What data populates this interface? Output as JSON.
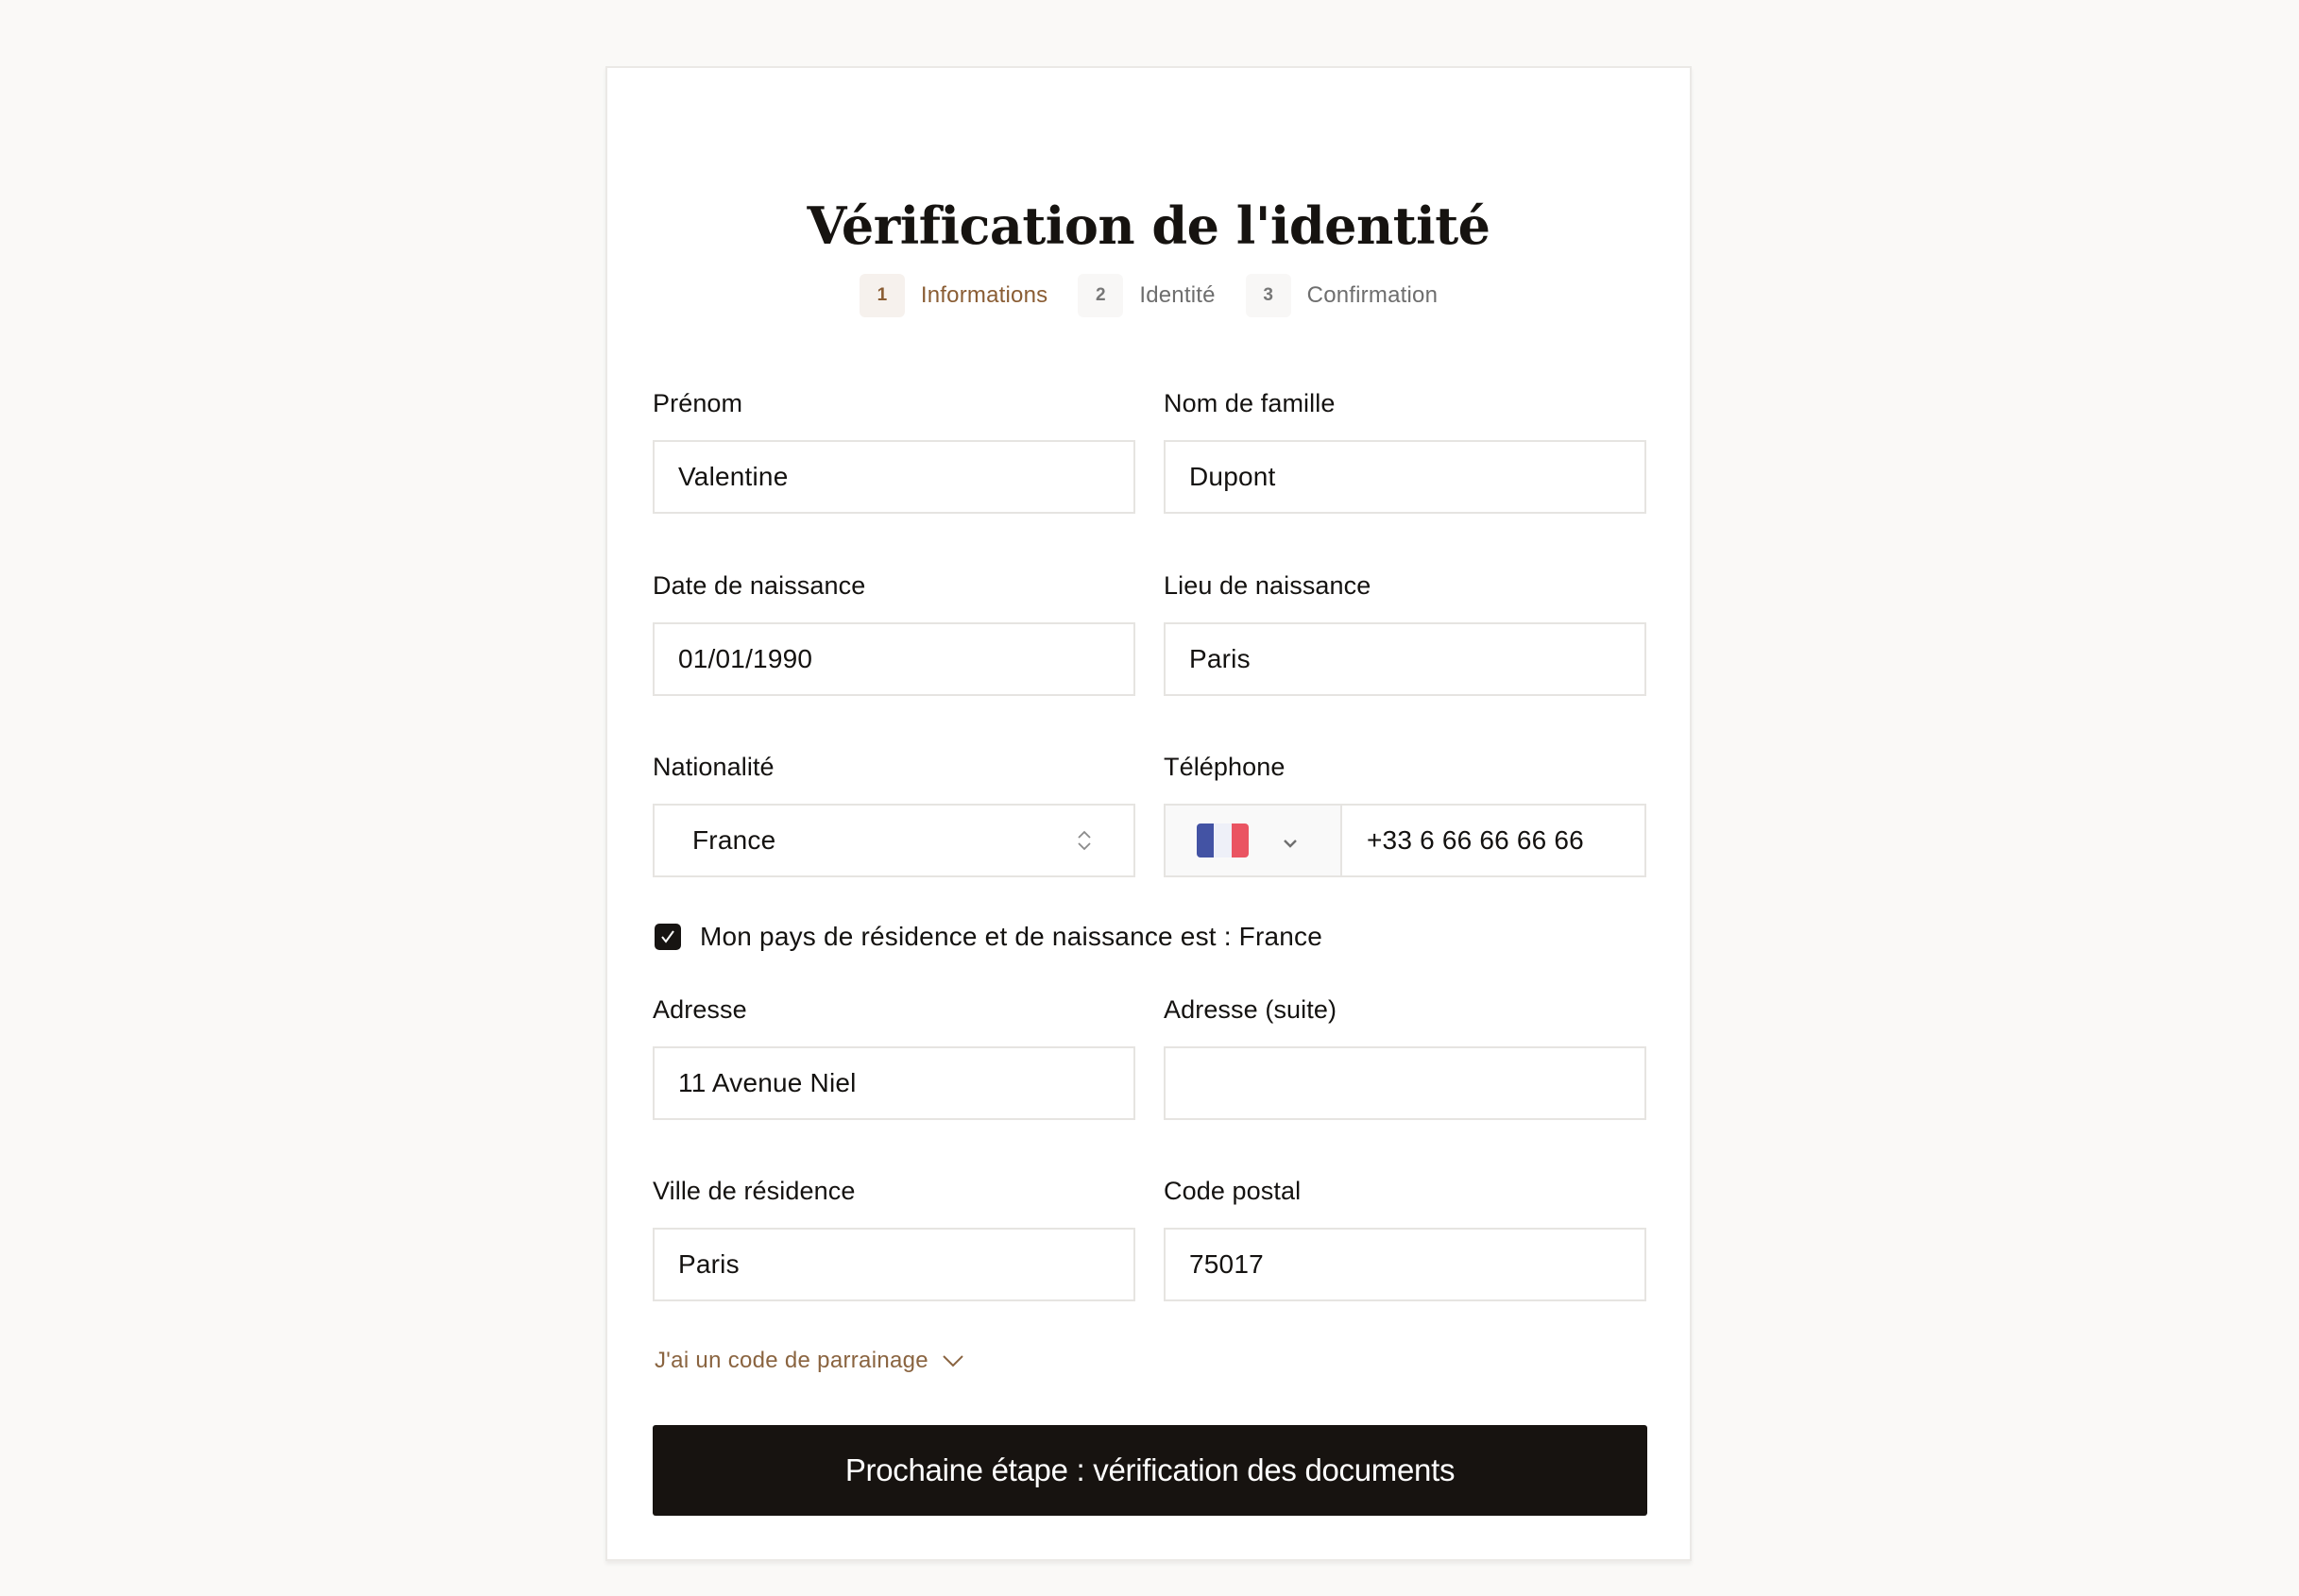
{
  "page": {
    "title": "Vérification de l'identité"
  },
  "steps": [
    {
      "number": "1",
      "label": "Informations",
      "active": true
    },
    {
      "number": "2",
      "label": "Identité",
      "active": false
    },
    {
      "number": "3",
      "label": "Confirmation",
      "active": false
    }
  ],
  "form": {
    "first_name": {
      "label": "Prénom",
      "value": "Valentine"
    },
    "last_name": {
      "label": "Nom de famille",
      "value": "Dupont"
    },
    "birth_date": {
      "label": "Date de naissance",
      "value": "01/01/1990"
    },
    "birth_place": {
      "label": "Lieu de naissance",
      "value": "Paris"
    },
    "nationality": {
      "label": "Nationalité",
      "value": "France",
      "icon": "chevron-up-down-icon"
    },
    "phone": {
      "label": "Téléphone",
      "country_flag": "france-flag",
      "country_colors": [
        "#4353a4",
        "#eef0f8",
        "#ea5462"
      ],
      "value": "+33 6 66 66 66 66",
      "icon": "chevron-down-icon"
    },
    "same_country_checkbox": {
      "label": "Mon pays de résidence et de naissance est : France",
      "checked": true
    },
    "address": {
      "label": "Adresse",
      "value": "11 Avenue Niel"
    },
    "address_2": {
      "label": "Adresse (suite)",
      "value": ""
    },
    "city": {
      "label": "Ville de résidence",
      "value": "Paris"
    },
    "postal_code": {
      "label": "Code postal",
      "value": "75017"
    }
  },
  "referral": {
    "label": "J'ai un code de parrainage",
    "icon": "chevron-down-icon"
  },
  "submit": {
    "label": "Prochaine étape : vérification des documents"
  },
  "colors": {
    "accent": "#8a5d34",
    "button_bg": "#171310",
    "page_bg": "#faf9f7"
  }
}
